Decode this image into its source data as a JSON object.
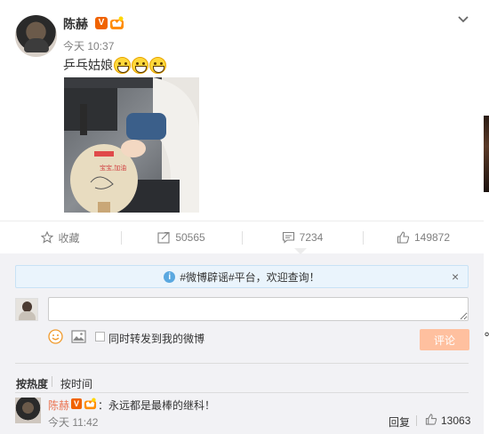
{
  "post": {
    "author": "陈赫",
    "verified_badge": "V",
    "time": "今天 10:37",
    "text": "乒乓姑娘",
    "emoji_count": 3
  },
  "actions": [
    {
      "icon": "star-icon",
      "label": "收藏"
    },
    {
      "icon": "share-icon",
      "label": "50565"
    },
    {
      "icon": "comment-icon",
      "label": "7234"
    },
    {
      "icon": "thumbs-up-icon",
      "label": "149872"
    }
  ],
  "comment_box": {
    "notice": "#微博辟谣#平台，欢迎查询！",
    "notice_close": "×",
    "input_value": "",
    "repost_label": "同时转发到我的微博",
    "submit_label": "评论"
  },
  "sort": {
    "hot": "按热度",
    "time": "按时间"
  },
  "comments": [
    {
      "author": "陈赫",
      "verified_badge": "V",
      "text": "：永远都是最棒的继科！",
      "time": "今天 11:42",
      "reply_label": "回复",
      "likes": "13063"
    }
  ],
  "edge_glyph": "℃",
  "colors": {
    "accent_orange": "#eb7350",
    "submit_disabled": "#ffc09f",
    "verified": "#f06300",
    "notice_bg": "#eaf4fc"
  }
}
